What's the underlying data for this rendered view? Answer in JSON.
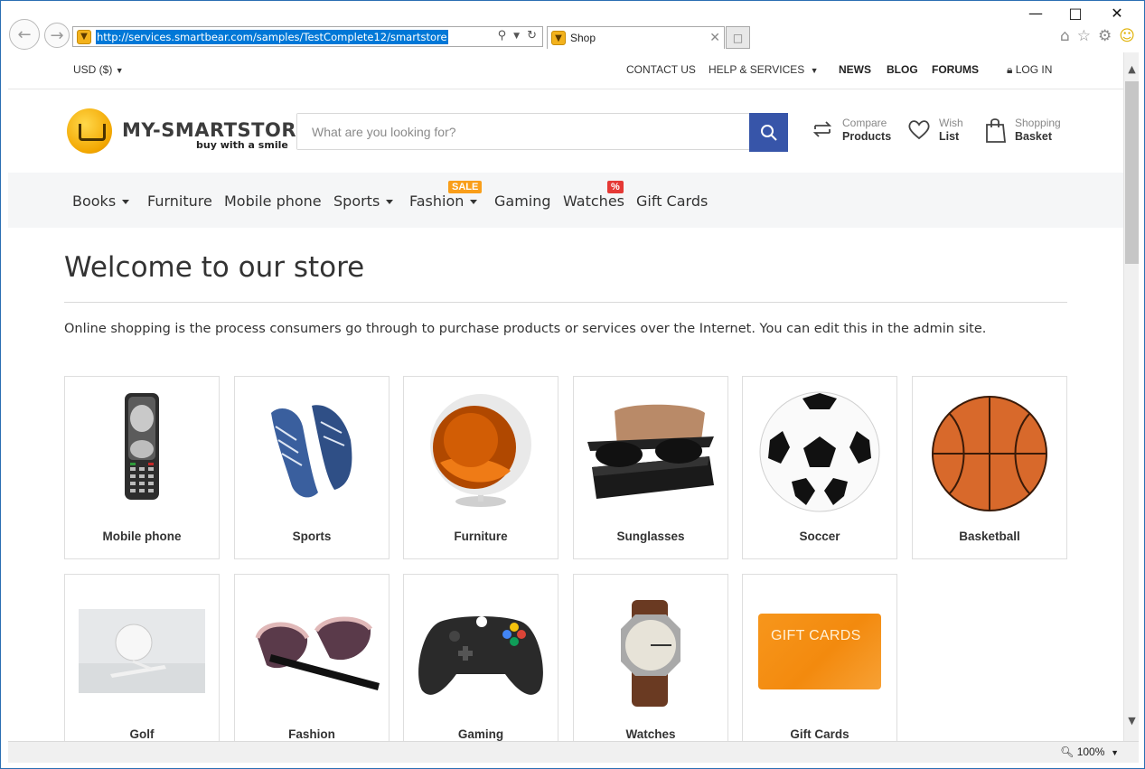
{
  "browser": {
    "url": "http://services.smartbear.com/samples/TestComplete12/smartstore",
    "tab_title": "Shop",
    "zoom": "100%"
  },
  "topbar": {
    "currency": "USD ($)",
    "contact_us": "CONTACT US",
    "help_services": "HELP & SERVICES",
    "news": "NEWS",
    "blog": "BLOG",
    "forums": "FORUMS",
    "login": "LOG IN"
  },
  "header": {
    "logo_name": "MY-SMARTSTORE",
    "logo_tagline": "buy with a smile",
    "search_placeholder": "What are you looking for?",
    "compare_small": "Compare",
    "compare_big": "Products",
    "wish_small": "Wish",
    "wish_big": "List",
    "basket_small": "Shopping",
    "basket_big": "Basket"
  },
  "menu": {
    "items": [
      {
        "label": "Books",
        "dropdown": true
      },
      {
        "label": "Furniture",
        "dropdown": false
      },
      {
        "label": "Mobile phone",
        "dropdown": false
      },
      {
        "label": "Sports",
        "dropdown": true
      },
      {
        "label": "Fashion",
        "dropdown": true
      },
      {
        "label": "Gaming",
        "dropdown": false
      },
      {
        "label": "Watches",
        "dropdown": false
      },
      {
        "label": "Gift Cards",
        "dropdown": false
      }
    ],
    "sale_badge": "SALE",
    "percent_badge": "%"
  },
  "main": {
    "title": "Welcome to our store",
    "intro": "Online shopping is the process consumers go through to purchase products or services over the Internet. You can edit this in the admin site.",
    "categories": [
      {
        "label": "Mobile phone",
        "icon": "mobile-phone"
      },
      {
        "label": "Sports",
        "icon": "sneakers"
      },
      {
        "label": "Furniture",
        "icon": "egg-chair"
      },
      {
        "label": "Sunglasses",
        "icon": "sunglasses-case"
      },
      {
        "label": "Soccer",
        "icon": "soccer-ball"
      },
      {
        "label": "Basketball",
        "icon": "basketball"
      },
      {
        "label": "Golf",
        "icon": "golf-ball"
      },
      {
        "label": "Fashion",
        "icon": "fashion-sunglasses"
      },
      {
        "label": "Gaming",
        "icon": "game-controller"
      },
      {
        "label": "Watches",
        "icon": "wristwatch"
      },
      {
        "label": "Gift Cards",
        "icon": "gift-card"
      }
    ],
    "gift_card_text": "GIFT CARDS"
  },
  "colors": {
    "accent": "#3755a9",
    "sale": "#f99e1a",
    "percent": "#e53935",
    "menubar_bg": "#f5f6f7"
  }
}
